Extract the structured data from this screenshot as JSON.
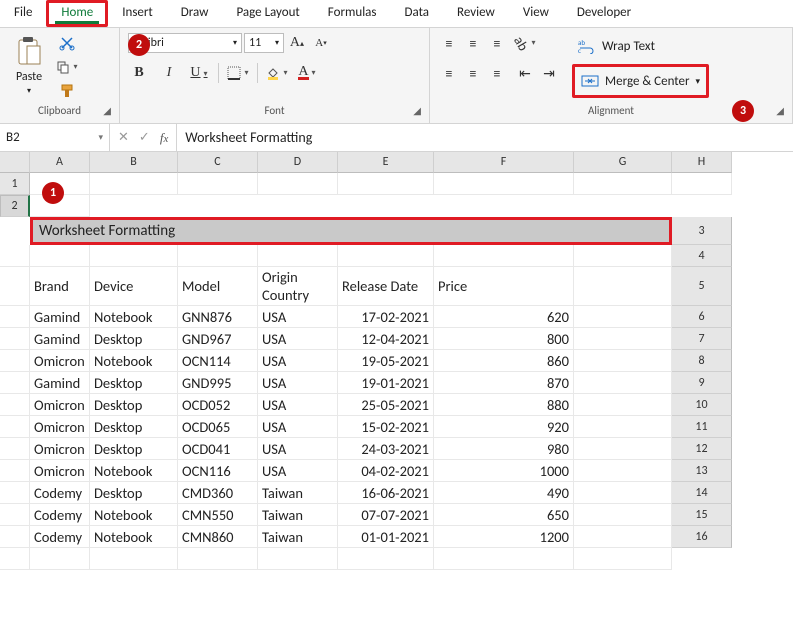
{
  "tabs": [
    "File",
    "Home",
    "Insert",
    "Draw",
    "Page Layout",
    "Formulas",
    "Data",
    "Review",
    "View",
    "Developer"
  ],
  "active_tab": "Home",
  "ribbon": {
    "clipboard": {
      "paste": "Paste",
      "label": "Clipboard"
    },
    "font": {
      "name": "Calibri",
      "size": "11",
      "bold": "B",
      "italic": "I",
      "underline": "U",
      "label": "Font"
    },
    "alignment": {
      "wrap": "Wrap Text",
      "merge": "Merge & Center",
      "label": "Alignment"
    }
  },
  "namebox": "B2",
  "formula": "Worksheet Formatting",
  "badges": {
    "b1": "1",
    "b2": "2",
    "b3": "3"
  },
  "columns": [
    "A",
    "B",
    "C",
    "D",
    "E",
    "F",
    "G",
    "H"
  ],
  "title_cell": "Worksheet Formatting",
  "headers": {
    "brand": "Brand",
    "device": "Device",
    "model": "Model",
    "origin": "Origin Country",
    "release": "Release Date",
    "price": "Price"
  },
  "rows": [
    {
      "brand": "Gamind",
      "device": "Notebook",
      "model": "GNN876",
      "origin": "USA",
      "release": "17-02-2021",
      "price": "620"
    },
    {
      "brand": "Gamind",
      "device": "Desktop",
      "model": "GND967",
      "origin": "USA",
      "release": "12-04-2021",
      "price": "800"
    },
    {
      "brand": "Omicron",
      "device": "Notebook",
      "model": "OCN114",
      "origin": "USA",
      "release": "19-05-2021",
      "price": "860"
    },
    {
      "brand": "Gamind",
      "device": "Desktop",
      "model": "GND995",
      "origin": "USA",
      "release": "19-01-2021",
      "price": "870"
    },
    {
      "brand": "Omicron",
      "device": "Desktop",
      "model": "OCD052",
      "origin": "USA",
      "release": "25-05-2021",
      "price": "880"
    },
    {
      "brand": "Omicron",
      "device": "Desktop",
      "model": "OCD065",
      "origin": "USA",
      "release": "15-02-2021",
      "price": "920"
    },
    {
      "brand": "Omicron",
      "device": "Desktop",
      "model": "OCD041",
      "origin": "USA",
      "release": "24-03-2021",
      "price": "980"
    },
    {
      "brand": "Omicron",
      "device": "Notebook",
      "model": "OCN116",
      "origin": "USA",
      "release": "04-02-2021",
      "price": "1000"
    },
    {
      "brand": "Codemy",
      "device": "Desktop",
      "model": "CMD360",
      "origin": "Taiwan",
      "release": "16-06-2021",
      "price": "490"
    },
    {
      "brand": "Codemy",
      "device": "Notebook",
      "model": "CMN550",
      "origin": "Taiwan",
      "release": "07-07-2021",
      "price": "650"
    },
    {
      "brand": "Codemy",
      "device": "Notebook",
      "model": "CMN860",
      "origin": "Taiwan",
      "release": "01-01-2021",
      "price": "1200"
    }
  ]
}
